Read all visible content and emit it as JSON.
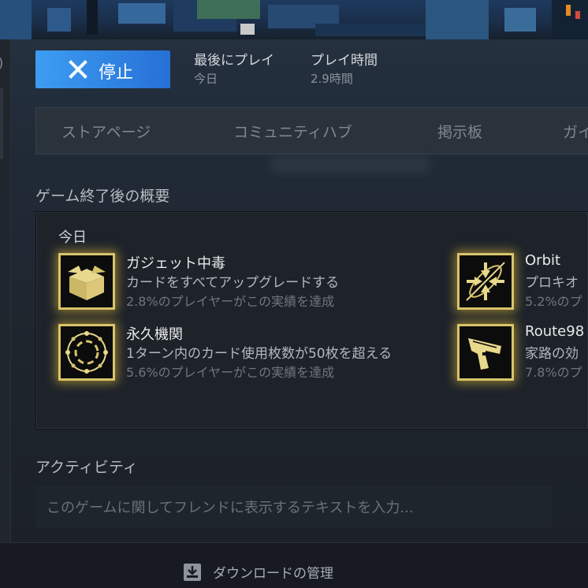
{
  "play_bar": {
    "stop_label": "停止",
    "last_played_label": "最後にプレイ",
    "last_played_value": "今日",
    "playtime_label": "プレイ時間",
    "playtime_value": "2.9時間"
  },
  "tabs": [
    {
      "label": "ストアページ"
    },
    {
      "label": "コミュニティハブ"
    },
    {
      "label": "掲示板"
    },
    {
      "label": "ガイ"
    }
  ],
  "post_game": {
    "title": "ゲーム終了後の概要",
    "day_label": "今日",
    "achievements": [
      {
        "name": "ガジェット中毒",
        "desc": "カードをすべてアップグレードする",
        "pct": "2.8%のプレイヤーがこの実績を達成",
        "icon": "box-icon"
      },
      {
        "name": "永久機関",
        "desc": "1ターン内のカード使用枚数が50枚を超える",
        "pct": "5.6%のプレイヤーがこの実績を達成",
        "icon": "orbit-ring-icon"
      },
      {
        "name": "Orbit",
        "desc": "プロキオ",
        "pct": "5.2%のプ",
        "icon": "converge-arrows-icon"
      },
      {
        "name": "Route98",
        "desc": "家路の効",
        "pct": "7.8%のプ",
        "icon": "pistol-icon"
      }
    ]
  },
  "activity": {
    "title": "アクティビティ",
    "placeholder": "このゲームに関してフレンドに表示するテキストを入力..."
  },
  "footer": {
    "downloads_label": "ダウンロードの管理"
  },
  "colors": {
    "accent_blue_start": "#3d9df2",
    "accent_blue_end": "#2670d6",
    "achievement_gold": "#d8c46a"
  }
}
